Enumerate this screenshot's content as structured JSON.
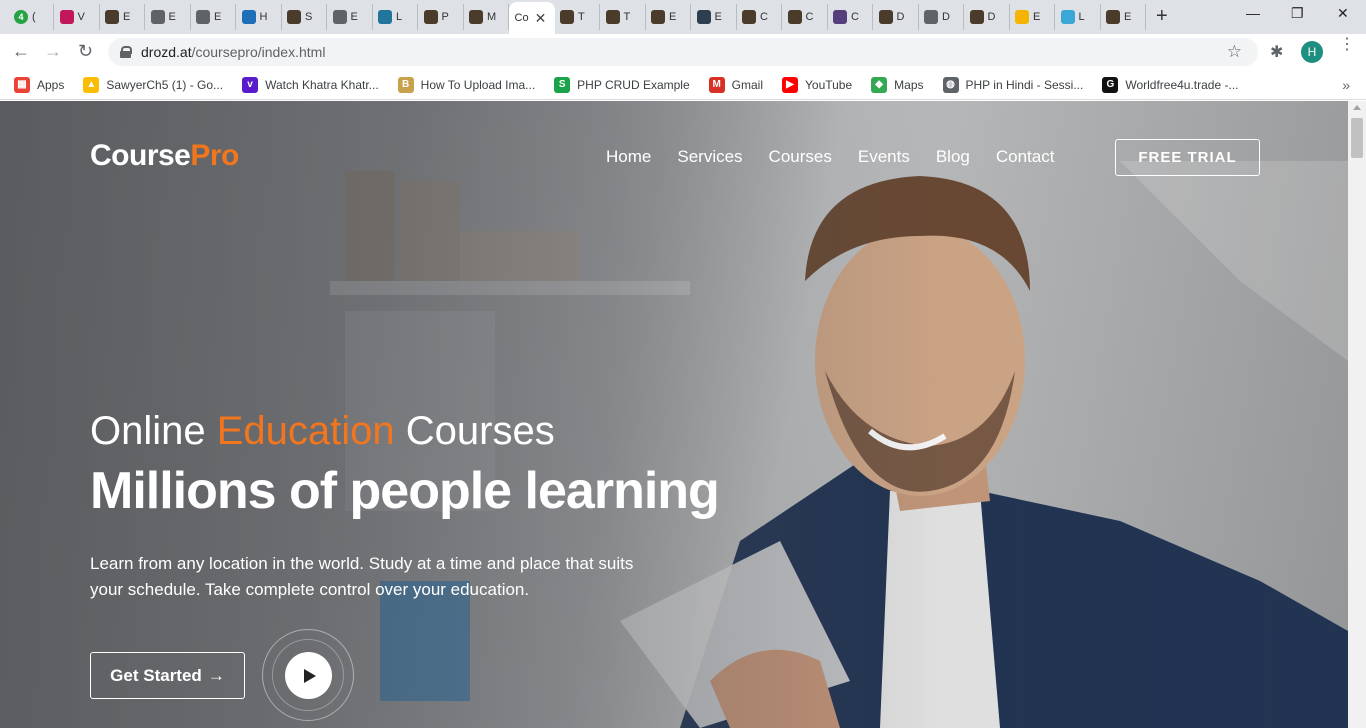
{
  "browser": {
    "tabs": [
      {
        "letter": "(",
        "color": "#25a244",
        "badge": "4"
      },
      {
        "letter": "V",
        "color": "#c2185b"
      },
      {
        "letter": "E",
        "color": "#4a3b2a"
      },
      {
        "letter": "E",
        "color": "#5f6368"
      },
      {
        "letter": "E",
        "color": "#5f6368"
      },
      {
        "letter": "H",
        "color": "#1e6fb8"
      },
      {
        "letter": "S",
        "color": "#4a3b2a"
      },
      {
        "letter": "E",
        "color": "#5f6368"
      },
      {
        "letter": "L",
        "color": "#21759b"
      },
      {
        "letter": "P",
        "color": "#4a3b2a"
      },
      {
        "letter": "M",
        "color": "#4a3b2a"
      },
      {
        "letter": "Co",
        "color": "#ffffff",
        "active": true
      },
      {
        "letter": "T",
        "color": "#4a3b2a"
      },
      {
        "letter": "T",
        "color": "#4a3b2a"
      },
      {
        "letter": "E",
        "color": "#4a3b2a"
      },
      {
        "letter": "E",
        "color": "#2c3e50"
      },
      {
        "letter": "C",
        "color": "#4a3b2a"
      },
      {
        "letter": "C",
        "color": "#4a3b2a"
      },
      {
        "letter": "C",
        "color": "#563d7c"
      },
      {
        "letter": "D",
        "color": "#4a3b2a"
      },
      {
        "letter": "D",
        "color": "#5f6368"
      },
      {
        "letter": "D",
        "color": "#4a3b2a"
      },
      {
        "letter": "E",
        "color": "#f4b400"
      },
      {
        "letter": "L",
        "color": "#3aa7d6"
      },
      {
        "letter": "E",
        "color": "#4a3b2a"
      }
    ],
    "active_tab_close": "✕",
    "new_tab": "+",
    "window_controls": {
      "minimize": "—",
      "restore": "❐",
      "close": "✕"
    },
    "nav": {
      "back": "←",
      "forward": "→",
      "reload": "↻"
    },
    "url": {
      "host": "drozd.at",
      "path": "/coursepro/index.html"
    },
    "star_icon": "☆",
    "extensions_icon": "✱",
    "profile_initial": "H",
    "menu_icon": "⋮"
  },
  "bookmarks": [
    {
      "label": "Apps",
      "icon": "apps-icon",
      "color": "#ea4335",
      "glyph": "▦"
    },
    {
      "label": "SawyerCh5 (1) - Go...",
      "icon": "drive-icon",
      "color": "#fbbc04",
      "glyph": "▲"
    },
    {
      "label": "Watch Khatra Khatr...",
      "icon": "voot-icon",
      "color": "#5a1ccb",
      "glyph": "v"
    },
    {
      "label": "How To Upload Ima...",
      "icon": "b-icon",
      "color": "#c8a24a",
      "glyph": "B"
    },
    {
      "label": "PHP CRUD Example",
      "icon": "s-icon",
      "color": "#1aa34a",
      "glyph": "S"
    },
    {
      "label": "Gmail",
      "icon": "gmail-icon",
      "color": "#d93025",
      "glyph": "M"
    },
    {
      "label": "YouTube",
      "icon": "youtube-icon",
      "color": "#ff0000",
      "glyph": "▶"
    },
    {
      "label": "Maps",
      "icon": "maps-icon",
      "color": "#34a853",
      "glyph": "◆"
    },
    {
      "label": "PHP in Hindi - Sessi...",
      "icon": "globe-icon",
      "color": "#5f6368",
      "glyph": "◍"
    },
    {
      "label": "Worldfree4u.trade -...",
      "icon": "g-icon",
      "color": "#111111",
      "glyph": "G"
    }
  ],
  "bookmarks_more": "»",
  "site": {
    "logo_main": "Course",
    "logo_accent": "Pro",
    "nav": [
      "Home",
      "Services",
      "Courses",
      "Events",
      "Blog",
      "Contact"
    ],
    "cta_trial": "FREE TRIAL",
    "sub_pre": "Online ",
    "sub_accent": "Education",
    "sub_post": " Courses",
    "headline": "Millions of people learning",
    "lead": "Learn from any location in the world. Study at a time and place that suits your schedule. Take complete control over your education.",
    "get_started": "Get Started",
    "arrow": "→"
  },
  "colors": {
    "accent": "#f2761e"
  }
}
